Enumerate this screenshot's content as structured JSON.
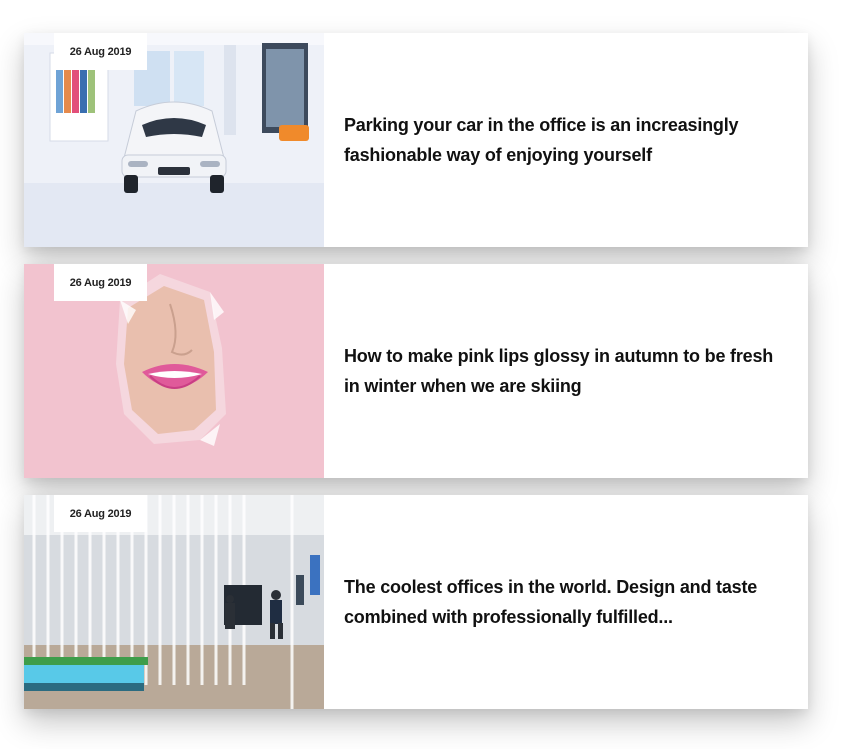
{
  "posts": [
    {
      "date": "26 Aug 2019",
      "title": "Parking your car in the office is an increasingly fashionable way of enjoying yourself",
      "image": "white sports car in white showroom office"
    },
    {
      "date": "26 Aug 2019",
      "title": "How to make pink lips glossy in autumn to be fresh in winter when we are skiing",
      "image": "lips peeking through torn pink paper"
    },
    {
      "date": "26 Aug 2019",
      "title": "The coolest offices in the world. Design and taste combined with professionally fulfilled...",
      "image": "modern office interior with hanging white rods"
    }
  ]
}
